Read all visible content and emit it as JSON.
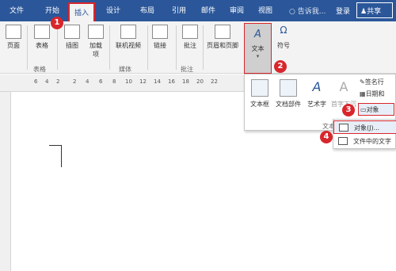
{
  "tabs": [
    "文件",
    "开始",
    "插入",
    "设计",
    "布局",
    "引用",
    "邮件",
    "审阅",
    "视图"
  ],
  "tell_me": "告诉我...",
  "login": "登录",
  "share": "共享",
  "ribbon": {
    "buttons": [
      {
        "label": "页面"
      },
      {
        "label": "表格"
      },
      {
        "label": "插图"
      },
      {
        "label": "加载\n项"
      },
      {
        "label": "联机视频"
      },
      {
        "label": "链接"
      },
      {
        "label": "批注"
      },
      {
        "label": "页眉和页脚"
      },
      {
        "label": "文本"
      },
      {
        "label": "符号"
      }
    ],
    "groups": [
      {
        "label": "表格"
      },
      {
        "label": "媒体"
      },
      {
        "label": "批注"
      }
    ]
  },
  "ruler": [
    "6",
    "4",
    "2",
    "2",
    "4",
    "6",
    "8",
    "10",
    "12",
    "14",
    "16",
    "18",
    "20",
    "22"
  ],
  "dropdown": {
    "items": [
      {
        "label": "文本框"
      },
      {
        "label": "文档部件"
      },
      {
        "label": "艺术字"
      },
      {
        "label": "首字下沉"
      }
    ],
    "right": [
      {
        "label": "签名行"
      },
      {
        "label": "日期和"
      },
      {
        "label": "对象"
      }
    ],
    "group_label": "文本"
  },
  "submenu": {
    "items": [
      {
        "label": "对象(J)..."
      },
      {
        "label": "文件中的文字"
      }
    ]
  },
  "badges": [
    "1",
    "2",
    "3",
    "4"
  ]
}
